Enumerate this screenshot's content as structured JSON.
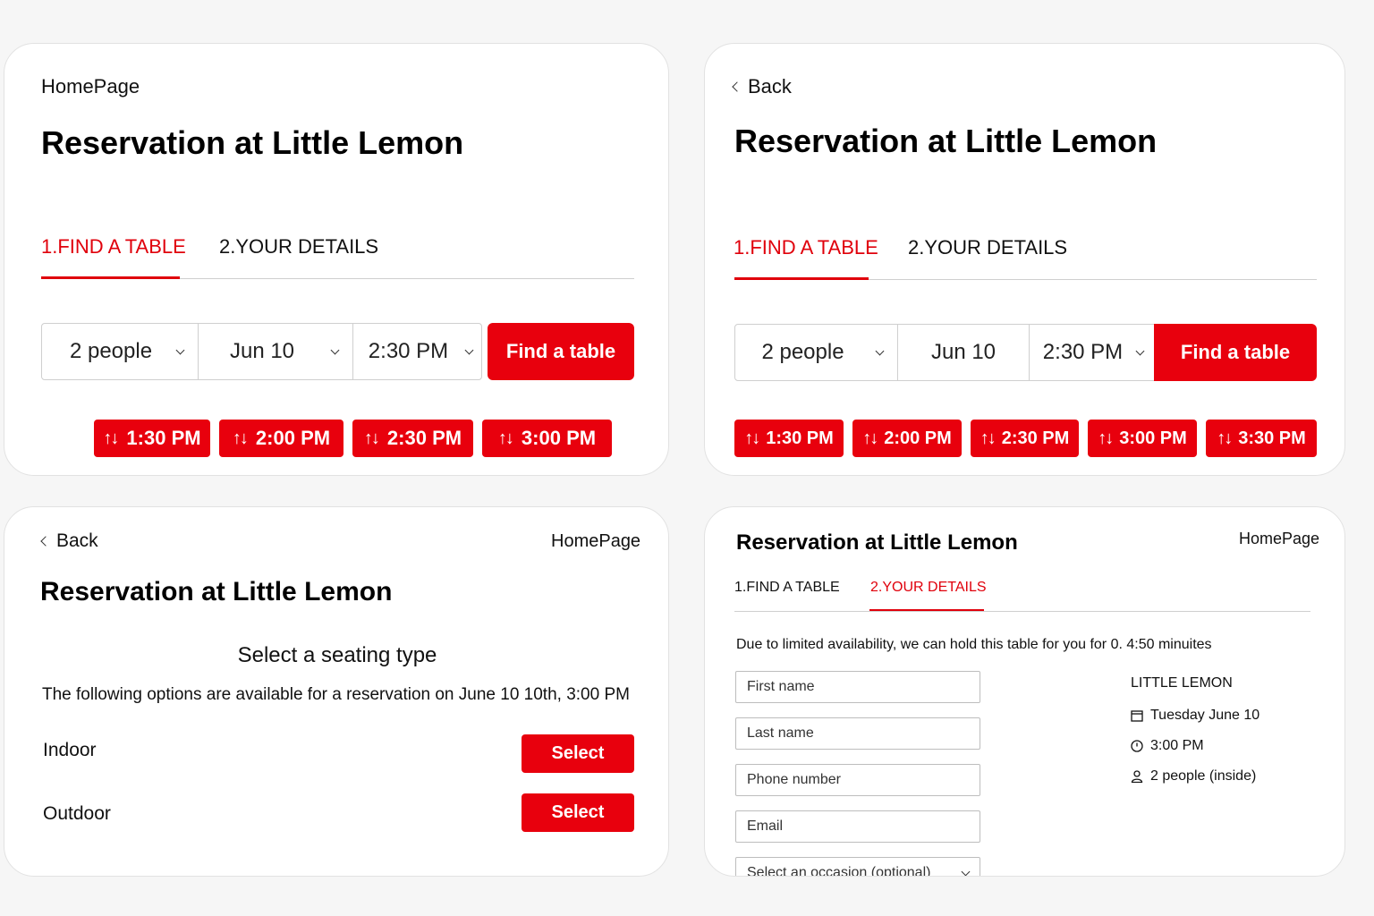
{
  "card1": {
    "nav": "HomePage",
    "title": "Reservation at Little Lemon",
    "tabs": [
      "1.FIND A TABLE",
      "2.YOUR DETAILS"
    ],
    "people": "2 people",
    "date": "Jun 10",
    "time": "2:30 PM",
    "find_btn": "Find a table",
    "slots": [
      "1:30 PM",
      "2:00 PM",
      "2:30 PM",
      "3:00 PM"
    ]
  },
  "card2": {
    "back": "Back",
    "title": "Reservation at Little Lemon",
    "tabs": [
      "1.FIND A TABLE",
      "2.YOUR DETAILS"
    ],
    "people": "2 people",
    "date": "Jun 10",
    "time": "2:30 PM",
    "find_btn": "Find a table",
    "slots": [
      "1:30 PM",
      "2:00 PM",
      "2:30 PM",
      "3:00 PM",
      "3:30 PM"
    ]
  },
  "card3": {
    "back": "Back",
    "nav": "HomePage",
    "title": "Reservation at Little Lemon",
    "heading": "Select a seating type",
    "subtext": "The following options are available for a reservation on June 10 10th, 3:00 PM",
    "options": [
      {
        "label": "Indoor",
        "button": "Select"
      },
      {
        "label": "Outdoor",
        "button": "Select"
      }
    ]
  },
  "card4": {
    "title": "Reservation at Little Lemon",
    "nav": "HomePage",
    "tabs": [
      "1.FIND A TABLE",
      "2.YOUR DETAILS"
    ],
    "notice": "Due to limited availability, we can hold this table for you for 0. 4:50 minuites",
    "fields": {
      "first_name": "First name",
      "last_name": "Last name",
      "phone": "Phone number",
      "email": "Email",
      "occasion": "Select an occasion (optional)"
    },
    "summary": {
      "restaurant": "LITTLE LEMON",
      "date": "Tuesday June 10",
      "time": "3:00 PM",
      "party": "2 people (inside)"
    }
  },
  "colors": {
    "accent": "#e8000d",
    "tab_active": "#e0000b"
  },
  "icons": [
    "chevron-left-icon",
    "chevron-down-icon",
    "sort-icon",
    "calendar-icon",
    "clock-icon",
    "person-icon"
  ]
}
